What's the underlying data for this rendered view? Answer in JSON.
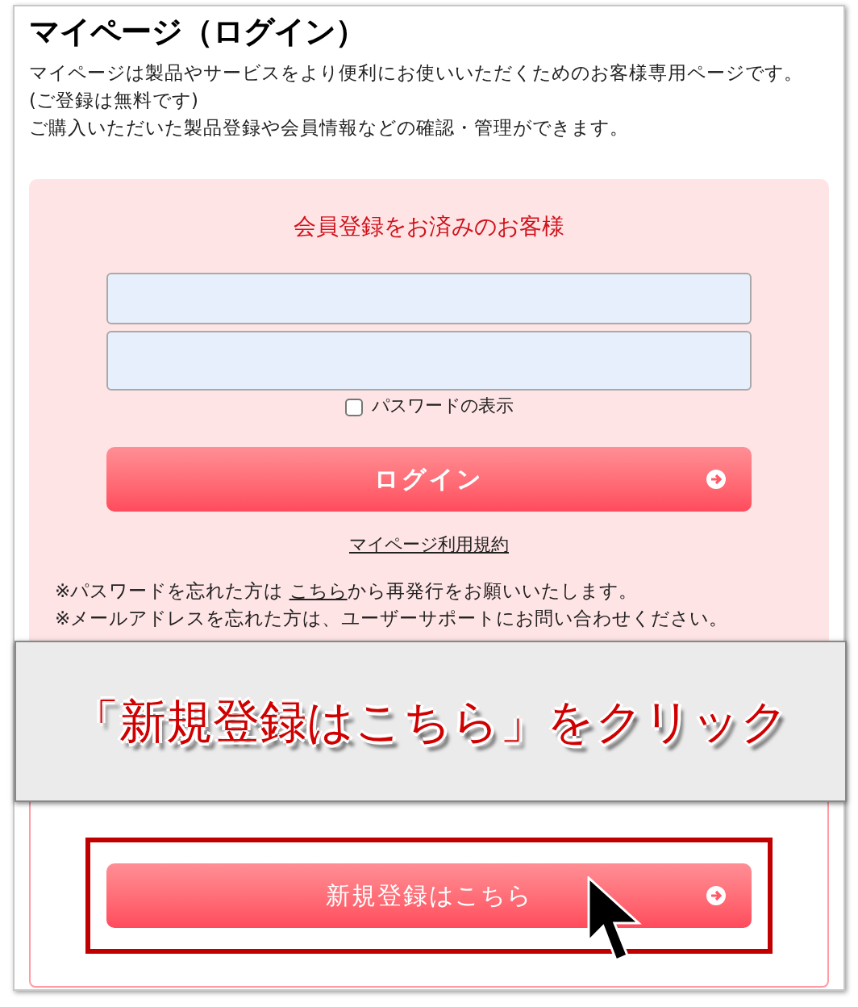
{
  "page": {
    "title": "マイページ（ログイン）",
    "intro": [
      "マイページは製品やサービスをより便利にお使いいただくためのお客様専用ページです。",
      "(ご登録は無料です)",
      "ご購入いただいた製品登録や会員情報などの確認・管理ができます。"
    ]
  },
  "login": {
    "heading": "会員登録をお済みのお客様",
    "fields": [
      {
        "kind": "text"
      },
      {
        "kind": "password"
      }
    ],
    "show_password": {
      "label": "パスワードの表示",
      "checked": false
    },
    "button": "ログイン",
    "terms_link": "マイページ利用規約",
    "notes": [
      {
        "before": "※パスワードを忘れた方は ",
        "link": "こちら",
        "after": "から再発行をお願いいたします。"
      },
      {
        "before": "※メールアドレスを忘れた方は、ユーザーサポートにお問い合わせください。"
      }
    ]
  },
  "register": {
    "button": "新規登録はこちら",
    "highlighted": true
  },
  "annotation": {
    "text": "「新規登録はこちら」をクリック"
  }
}
